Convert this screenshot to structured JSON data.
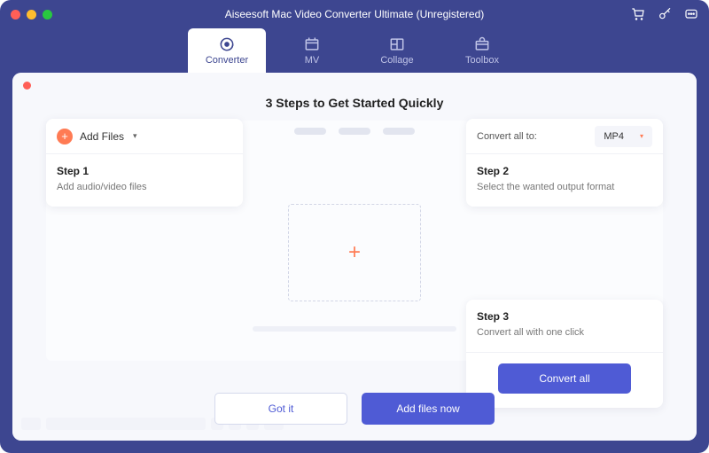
{
  "app": {
    "title": "Aiseesoft Mac Video Converter Ultimate (Unregistered)"
  },
  "nav": {
    "tabs": [
      {
        "label": "Converter"
      },
      {
        "label": "MV"
      },
      {
        "label": "Collage"
      },
      {
        "label": "Toolbox"
      }
    ]
  },
  "onboarding": {
    "title": "3 Steps to Get Started Quickly",
    "add_files_label": "Add Files",
    "convert_to_label": "Convert all to:",
    "format_value": "MP4",
    "steps": {
      "s1": {
        "title": "Step 1",
        "desc": "Add audio/video files"
      },
      "s2": {
        "title": "Step 2",
        "desc": "Select the wanted output format"
      },
      "s3": {
        "title": "Step 3",
        "desc": "Convert all with one click"
      }
    },
    "convert_all_label": "Convert all",
    "got_it_label": "Got it",
    "add_now_label": "Add files now"
  }
}
